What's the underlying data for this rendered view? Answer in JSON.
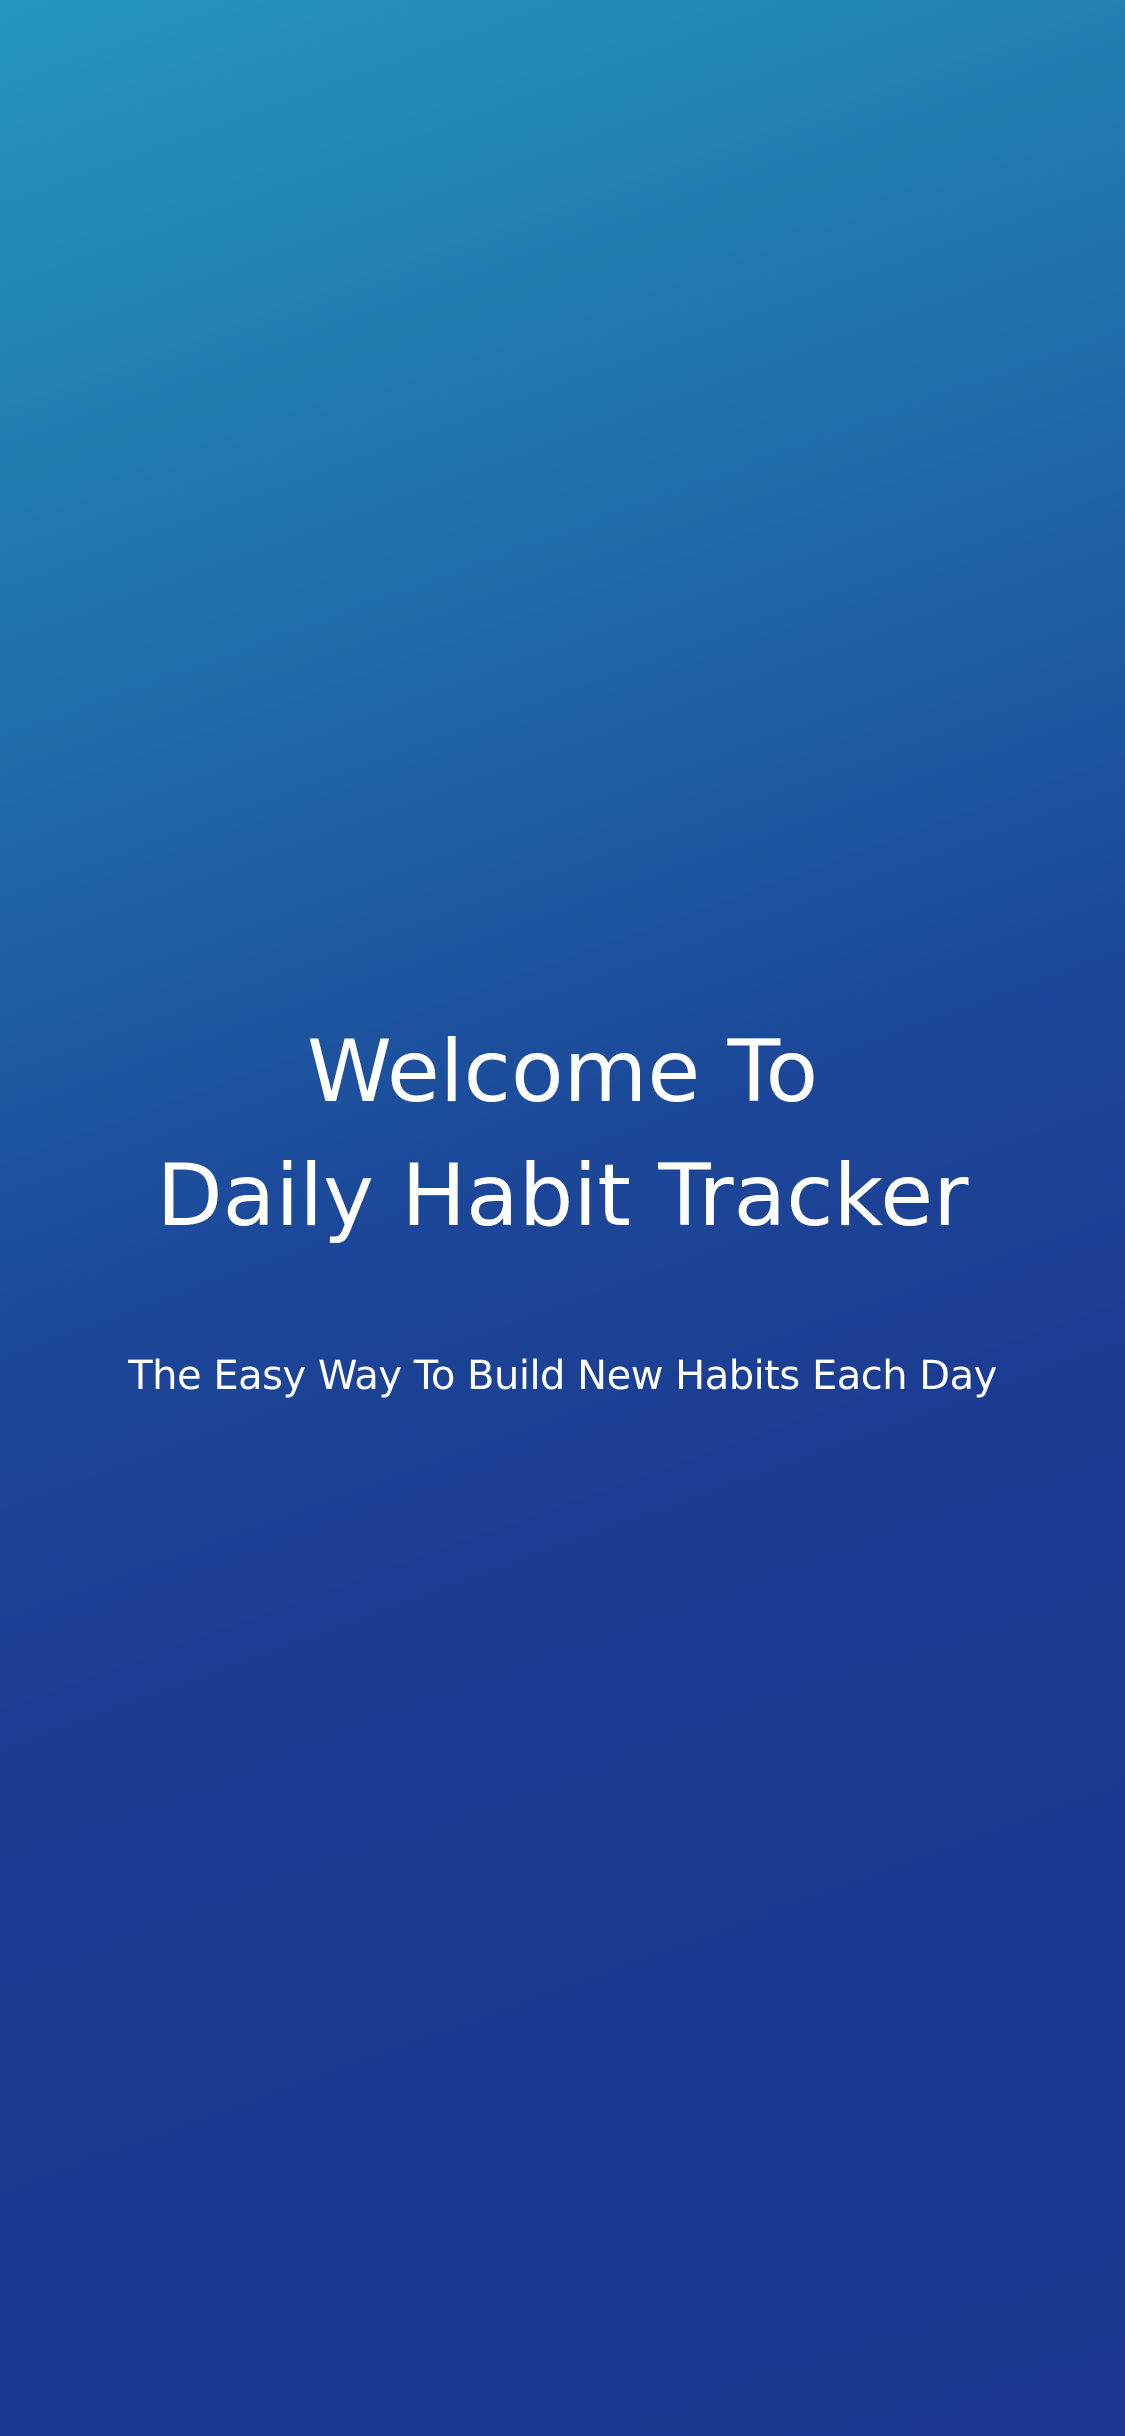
{
  "welcome": {
    "title_line_1": "Welcome To",
    "title_line_2": "Daily Habit Tracker",
    "subtitle": "The Easy Way To Build New Habits Each Day"
  },
  "colors": {
    "background_top": "#2496bd",
    "background_bottom": "#1b378f",
    "text": "#ffffff"
  }
}
